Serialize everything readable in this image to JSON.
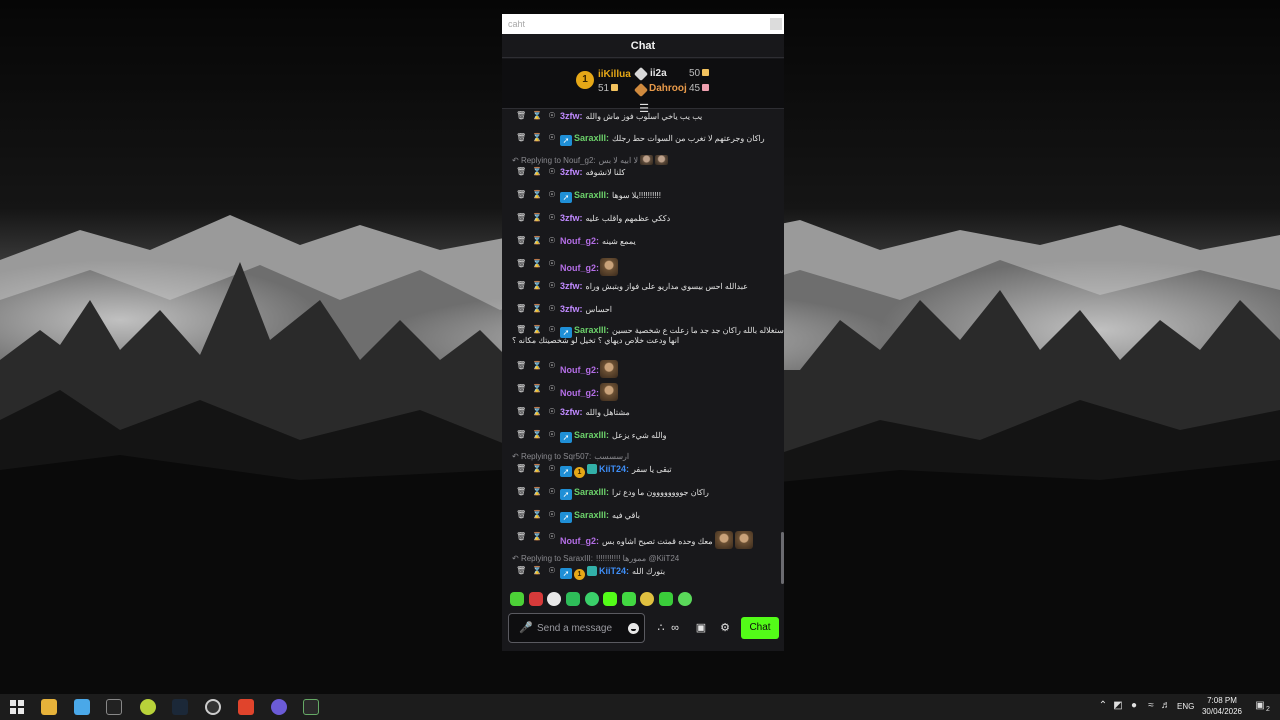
{
  "window": {
    "address_text": "caht",
    "header_title": "Chat"
  },
  "leaderboard": {
    "first": {
      "rank": "1",
      "name": "iiKillua",
      "count": "51"
    },
    "second": {
      "name": "ii2a",
      "count": "50"
    },
    "third": {
      "name": "Dahrooj",
      "count": "45"
    }
  },
  "messages": [
    {
      "user": "3zfw:",
      "text": "يب يب ياخي اسلوب فوز ماش والله",
      "color": "#c08aff"
    },
    {
      "user": "SaraxIII:",
      "text": "راكان وجرعتهم لا تغرب من السوات حط رجلك",
      "color": "#6bd06a"
    },
    {
      "reply": "Replying to Nouf_g2:",
      "reply_text": "لا ابيه لا بس"
    },
    {
      "user": "3zfw:",
      "text": "كلنا لانشوفه",
      "color": "#c08aff"
    },
    {
      "user": "SaraxIII:",
      "text": "يلا سوها!!!!!!!!!!",
      "color": "#6bd06a"
    },
    {
      "user": "3zfw:",
      "text": "دككي عظمهم واقلب عليه",
      "color": "#c08aff"
    },
    {
      "user": "Nouf_g2:",
      "text": "يممع شينه",
      "color": "#b46ee6"
    },
    {
      "user": "Nouf_g2:",
      "text": "",
      "color": "#b46ee6"
    },
    {
      "user": "3zfw:",
      "text": "عبدالله احس بيسوي مداريو على فواز وبتبش وراه",
      "color": "#c08aff"
    },
    {
      "user": "3zfw:",
      "text": "احساس",
      "color": "#c08aff"
    },
    {
      "user": "SaraxIII:",
      "text": "استغلاله بالله راكان جد جد ما زعلت ع شخصية حسين",
      "text2": "انها ودعت خلاص ديهاي ؟ تخيل لو شخصيتك مكانه ؟",
      "color": "#6bd06a"
    },
    {
      "user": "Nouf_g2:",
      "text": "",
      "color": "#b46ee6"
    },
    {
      "user": "Nouf_g2:",
      "text": "",
      "color": "#b46ee6"
    },
    {
      "user": "3zfw:",
      "text": "مشتاهل والله",
      "color": "#c08aff"
    },
    {
      "user": "SaraxIII:",
      "text": "والله شيء يزعل",
      "color": "#6bd06a"
    },
    {
      "reply": "Replying to Sqr507:",
      "reply_text": "ارسسسب"
    },
    {
      "user": "KiiT24:",
      "text": "تبقى يا سفر",
      "color": "#3e8ef7"
    },
    {
      "user": "SaraxIII:",
      "text": "راكان جوووووووون ما ودع ترا",
      "color": "#6bd06a"
    },
    {
      "user": "SaraxIII:",
      "text": "باقي فيه",
      "color": "#6bd06a"
    },
    {
      "user": "Nouf_g2:",
      "text": "معك وحده قمتت تصيح اشاوه بس",
      "color": "#b46ee6"
    },
    {
      "reply": "Replying to SaraxIII:",
      "reply_text": "!!!!!!!!!!! ممورها @KiiT24"
    },
    {
      "user": "KiiT24:",
      "text": "بتورك الله",
      "color": "#3e8ef7"
    }
  ],
  "input": {
    "placeholder": "Send a message",
    "chat_button": "Chat"
  },
  "taskbar": {
    "lang": "ENG",
    "time": "7:08 PM",
    "date": "30/04/2026",
    "notification_count": "2"
  }
}
